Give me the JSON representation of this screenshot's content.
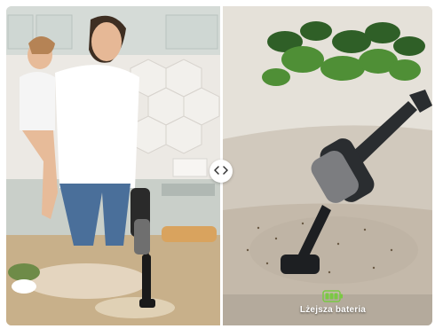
{
  "compare": {
    "handle_icon": "chevron-left-right-icon",
    "left_image": "family-kitchen-vacuum",
    "right_image": "sofa-vacuum-plant"
  },
  "battery": {
    "icon": "battery-icon",
    "label": "Lżejsza bateria",
    "color": "#7ac943"
  }
}
